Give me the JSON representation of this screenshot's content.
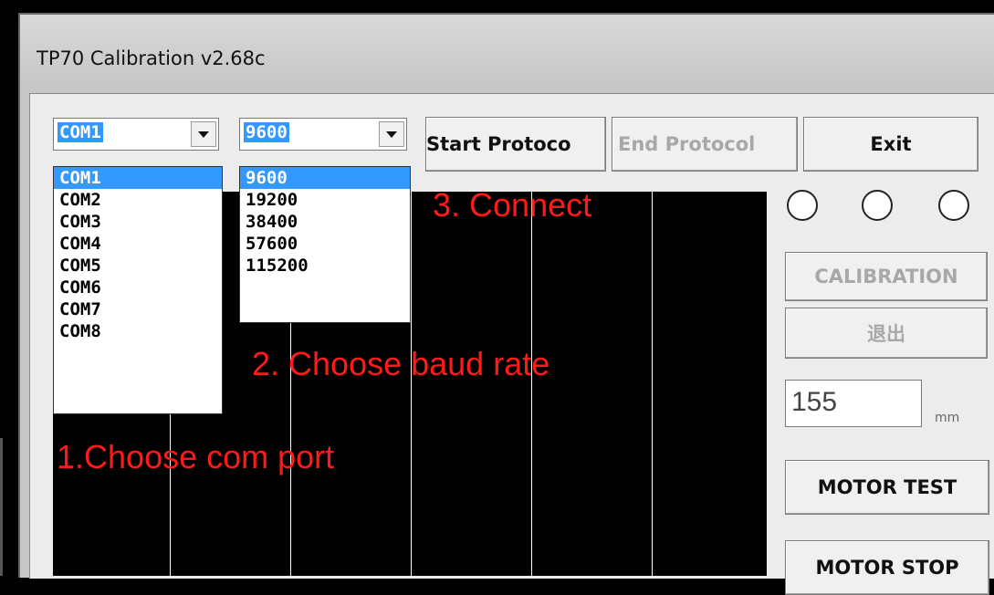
{
  "window": {
    "title": "TP70 Calibration v2.68c"
  },
  "port_combo": {
    "value": "COM1",
    "options": [
      "COM1",
      "COM2",
      "COM3",
      "COM4",
      "COM5",
      "COM6",
      "COM7",
      "COM8"
    ],
    "selected_index": 0
  },
  "baud_combo": {
    "value": "9600",
    "options": [
      "9600",
      "19200",
      "38400",
      "57600",
      "115200"
    ],
    "selected_index": 0
  },
  "buttons": {
    "start_protocol": "Start Protoco",
    "end_protocol": "End Protocol",
    "exit": "Exit",
    "calibration": "CALIBRATION",
    "quit_cn": "退出",
    "motor_test": "MOTOR TEST",
    "motor_stop": "MOTOR STOP"
  },
  "distance": {
    "value": "155",
    "unit": "mm"
  },
  "annotations": {
    "step1": "1.Choose com port",
    "step2": "2. Choose baud rate",
    "step3": "3. Connect"
  },
  "colors": {
    "annotation": "#ff1a1a",
    "selection": "#3399ff"
  }
}
